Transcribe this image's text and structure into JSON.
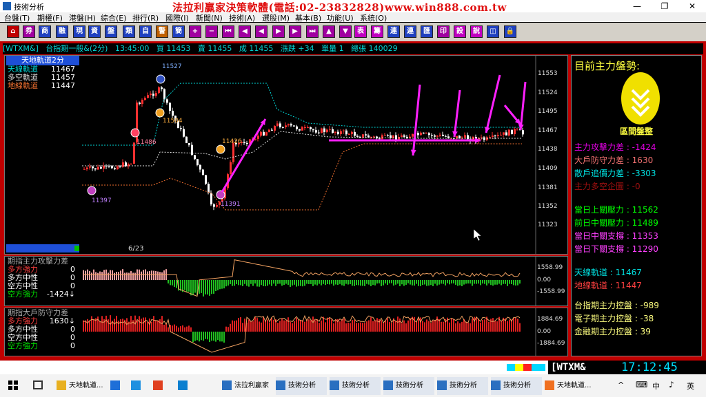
{
  "window": {
    "title": "技術分析",
    "minimize": "—",
    "maximize": "❐",
    "close": "✕"
  },
  "banner": "法拉利贏家決策軟體(電話:02-23832828)www.win888.com.tw",
  "menu": [
    "台盤(T)",
    "期權(F)",
    "港盤(H)",
    "綜合(E)",
    "排行(R)",
    "國際(I)",
    "新聞(N)",
    "技術(A)",
    "選股(M)",
    "基本(B)",
    "功能(U)",
    "系統(O)"
  ],
  "toolbar": [
    "⌂",
    "券",
    "商",
    "融",
    "現",
    "資",
    "盤",
    "類",
    "自",
    "警",
    "簡",
    "+",
    "−",
    "⏮",
    "◀",
    "◀",
    "▶",
    "▶",
    "⏭",
    "▲",
    "▼",
    "表",
    "籌",
    "連",
    "連",
    "匯",
    "印",
    "設",
    "說",
    "◫",
    "🔒"
  ],
  "info": {
    "symbol": "[WTXM&]",
    "name": "台指期一般&(2分)",
    "time": "13:45:00",
    "buy": "買 11453",
    "sell": "賣 11455",
    "deal": "成 11455",
    "change": "漲跌 +34",
    "single": "單量 1",
    "total": "總張 140029"
  },
  "main_legend": {
    "title": "天地軌道2分",
    "rows": [
      {
        "label": "天線軌道",
        "value": "11467"
      },
      {
        "label": "多空軌道",
        "value": "11457"
      },
      {
        "label": "地線軌道",
        "value": "11447"
      }
    ]
  },
  "main_axis": [
    "11553",
    "11524",
    "11495",
    "11467",
    "11438",
    "11409",
    "11381",
    "11352",
    "11323"
  ],
  "annotations": {
    "hi": "11527",
    "lo": "11397",
    "a1": "11504",
    "a2": "11486",
    "a3": "11426",
    "a4": "11391"
  },
  "date_label": "6/23",
  "sub1": {
    "title": "期指主力攻擊力差",
    "rows": [
      {
        "label": "多方強力",
        "value": "0"
      },
      {
        "label": "多方中性",
        "value": "0"
      },
      {
        "label": "空方中性",
        "value": "0"
      },
      {
        "label": "空方強力",
        "value": "-1424↓"
      }
    ],
    "axis": [
      "1558.99",
      "0.00",
      "-1558.99"
    ]
  },
  "sub2": {
    "title": "期指大戶防守力差",
    "rows": [
      {
        "label": "多方強力",
        "value": "1630↓"
      },
      {
        "label": "多方中性",
        "value": "0"
      },
      {
        "label": "空方中性",
        "value": "0"
      },
      {
        "label": "空方強力",
        "value": "0"
      }
    ],
    "axis": [
      "1884.69",
      "0.00",
      "-1884.69"
    ]
  },
  "right": {
    "title": "目前主力盤勢:",
    "badge": "區間盤整",
    "stats1": [
      {
        "text": "主力攻擊力差 : -1424",
        "color": "#e000e0"
      },
      {
        "text": "大戶防守力差 : 1630",
        "color": "#f07070"
      },
      {
        "text": "散戶追價力差 : -3303",
        "color": "#00e0e0"
      },
      {
        "text": "主力多空企圖 : -0",
        "color": "#a01010"
      }
    ],
    "stats2": [
      {
        "text": "當日上關壓力 : 11562",
        "color": "#00ff00"
      },
      {
        "text": "前日中關壓力 : 11489",
        "color": "#00ff00"
      },
      {
        "text": "當日中關支撐 : 11353",
        "color": "#ff40ff"
      },
      {
        "text": "當日下關支撐 : 11290",
        "color": "#ff40ff"
      }
    ],
    "stats3": [
      {
        "text": "天線軌道 : 11467",
        "color": "#00e0e0"
      },
      {
        "text": "地線軌道 : 11447",
        "color": "#ff4040"
      }
    ],
    "stats4": [
      {
        "text": "台指期主力控盤 : -989",
        "color": "#ffff80"
      },
      {
        "text": "電子期主力控盤 : -38",
        "color": "#ffff80"
      },
      {
        "text": "金融期主力控盤 : 39",
        "color": "#ffff80"
      }
    ]
  },
  "status": {
    "symbol": "WTXM&",
    "clock": "17:12:45"
  },
  "taskbar": [
    {
      "label": "天地軌道..."
    },
    {
      "label": ""
    },
    {
      "label": ""
    },
    {
      "label": ""
    },
    {
      "label": ""
    },
    {
      "label": "法拉利贏家"
    },
    {
      "label": "技術分析"
    },
    {
      "label": "技術分析"
    },
    {
      "label": "技術分析"
    },
    {
      "label": "技術分析"
    },
    {
      "label": "技術分析"
    },
    {
      "label": "天地軌道..."
    }
  ],
  "tray": {
    "ime": "中",
    "up": "^",
    "keyboard": "⌨",
    "vol": "♪",
    "lang": "英"
  }
}
